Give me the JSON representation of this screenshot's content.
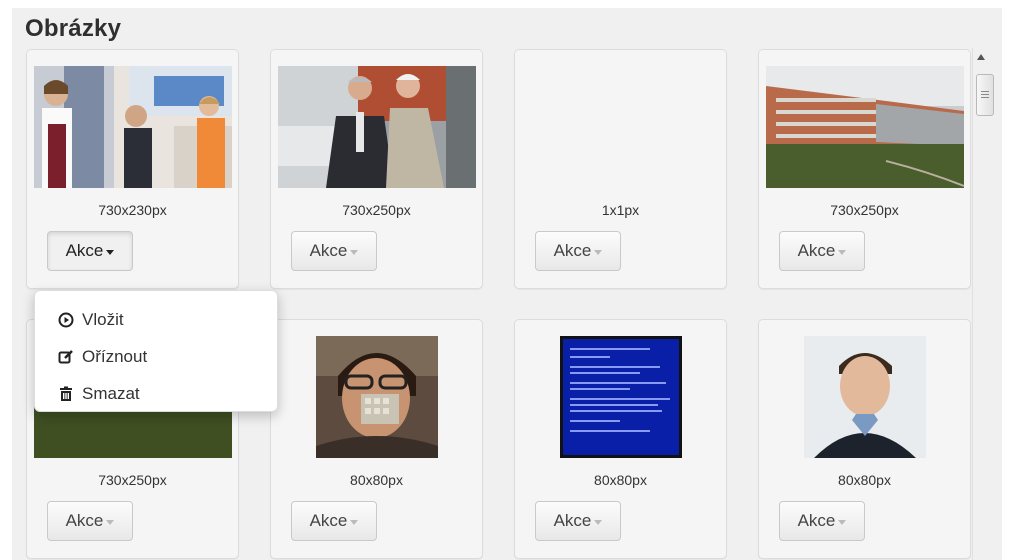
{
  "panel": {
    "title": "Obrázky"
  },
  "images": [
    {
      "size": "730x230px",
      "action_label": "Akce",
      "thumb_icon": "store-clerk-photo"
    },
    {
      "size": "730x250px",
      "action_label": "Akce",
      "thumb_icon": "two-men-photo"
    },
    {
      "size": "1x1px",
      "action_label": "Akce",
      "thumb_icon": "empty-image"
    },
    {
      "size": "730x250px",
      "action_label": "Akce",
      "thumb_icon": "building-photo"
    },
    {
      "size": "730x250px",
      "action_label": "Akce",
      "thumb_icon": "landscape-photo"
    },
    {
      "size": "80x80px",
      "action_label": "Akce",
      "thumb_icon": "man-portrait-photo"
    },
    {
      "size": "80x80px",
      "action_label": "Akce",
      "thumb_icon": "bluescreen-photo"
    },
    {
      "size": "80x80px",
      "action_label": "Akce",
      "thumb_icon": "young-man-portrait-photo"
    }
  ],
  "dropdown": {
    "items": [
      {
        "label": "Vložit",
        "icon": "play-circle-icon"
      },
      {
        "label": "Oříznout",
        "icon": "edit-icon"
      },
      {
        "label": "Smazat",
        "icon": "trash-icon"
      }
    ]
  },
  "colors": {
    "panel_bg": "#f0f0f0",
    "card_bg": "#f5f5f5",
    "bsod_blue": "#0a1fa8"
  }
}
